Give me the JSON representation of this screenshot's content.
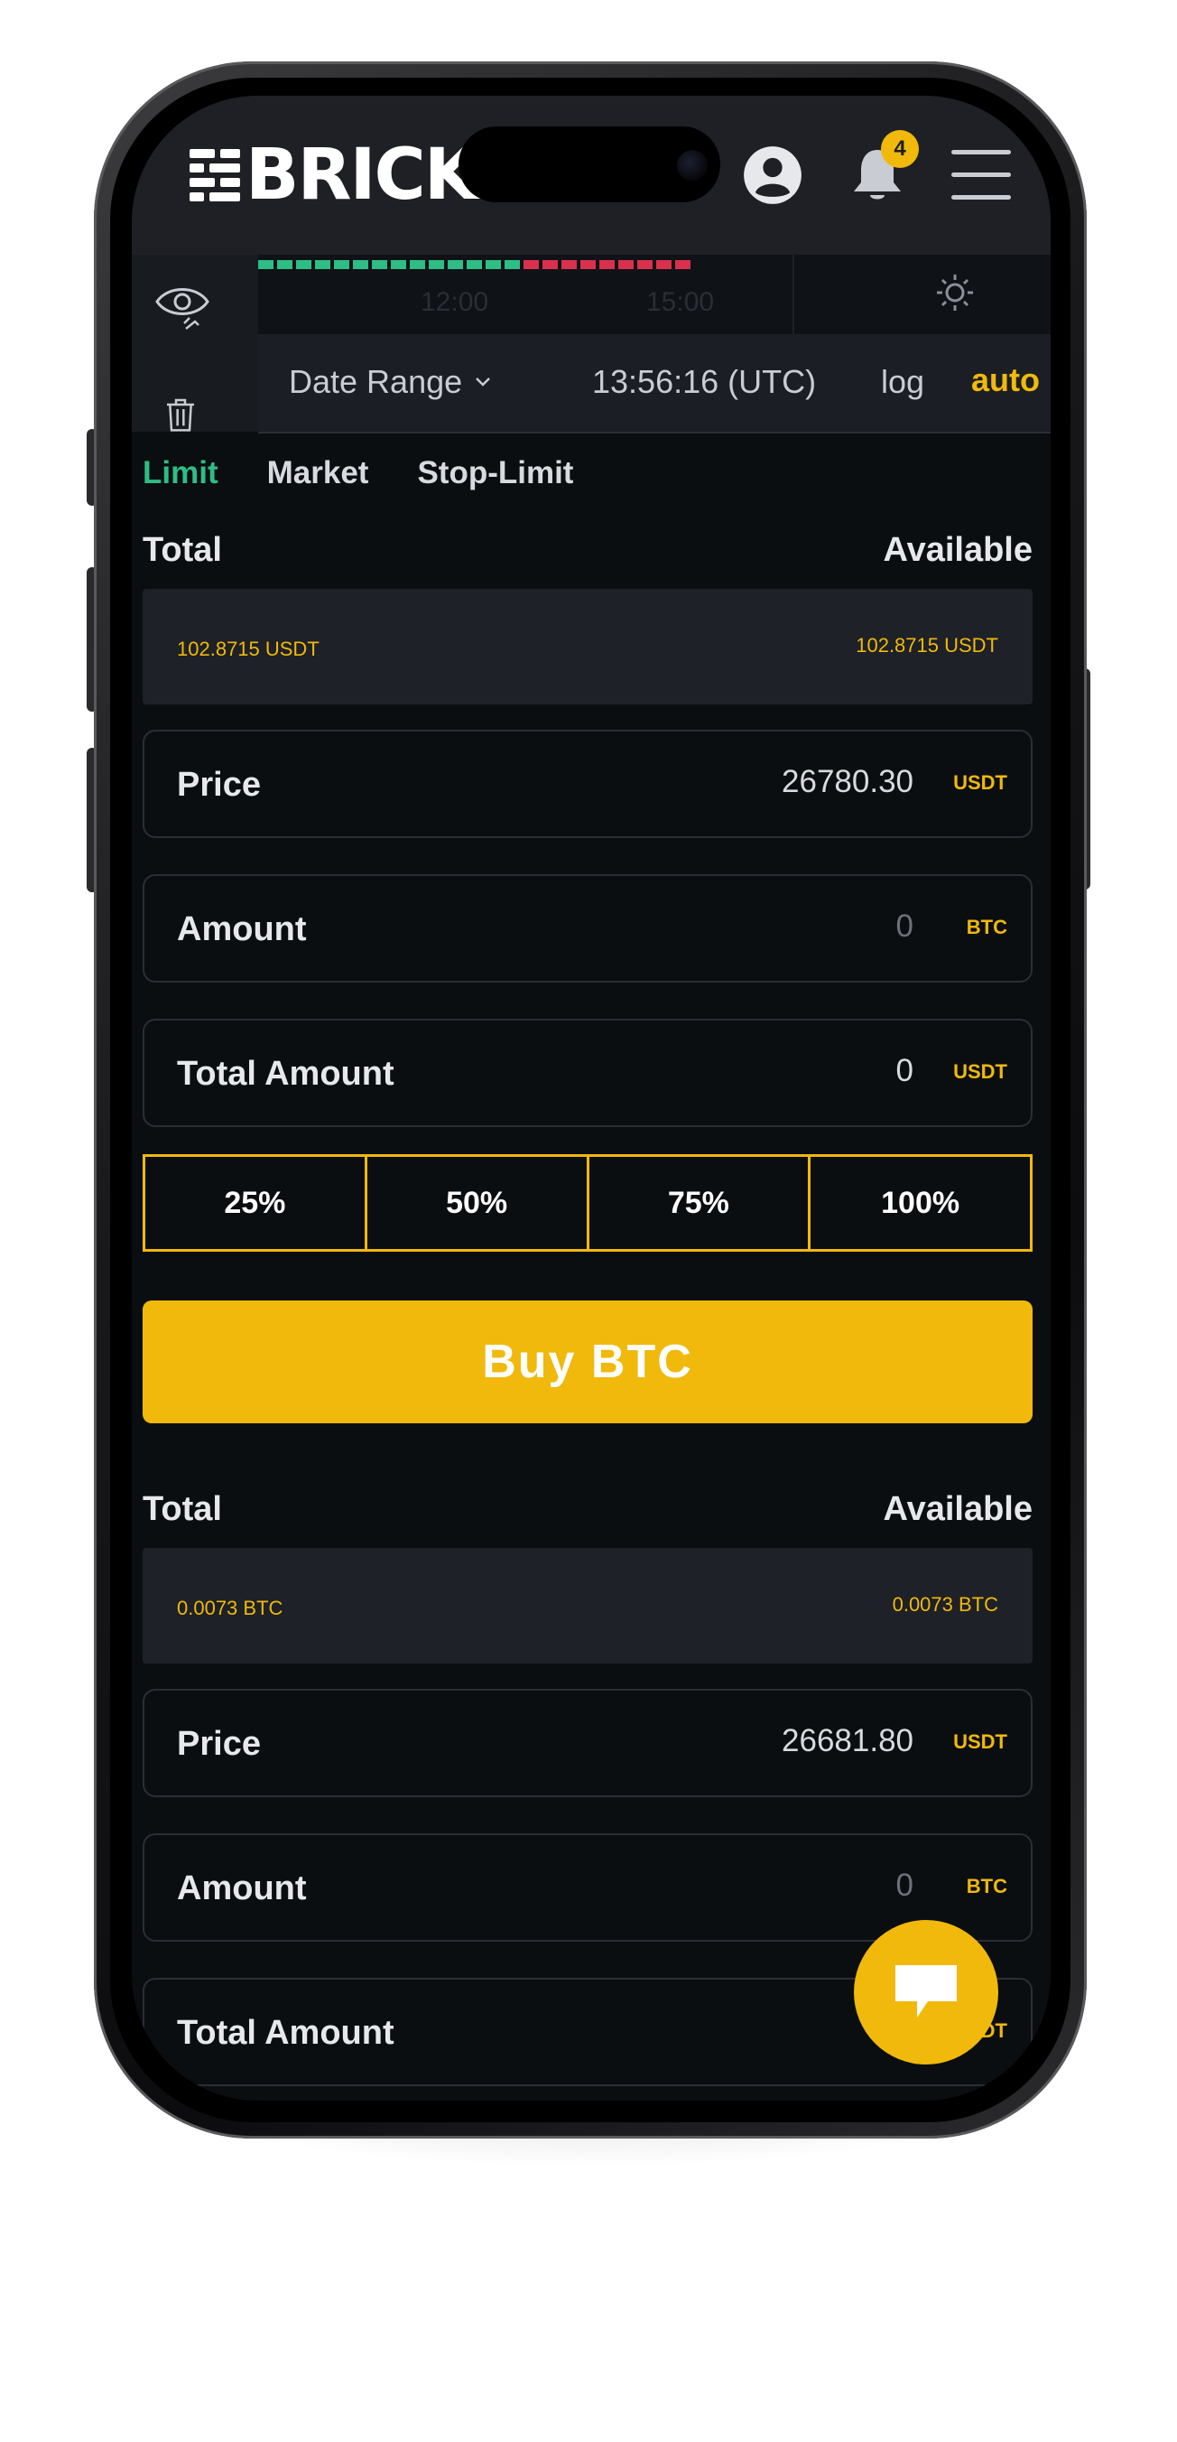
{
  "header": {
    "logo_text": "BRICK",
    "notification_count": "4",
    "icons": [
      "user-icon",
      "bell-icon",
      "menu-icon"
    ]
  },
  "chart": {
    "time_labels": [
      "12:00",
      "15:00"
    ],
    "date_range_label": "Date Range",
    "clock": "13:56:16 (UTC)",
    "log_label": "log",
    "auto_label": "auto"
  },
  "tabs": [
    {
      "label": "Limit",
      "active": true
    },
    {
      "label": "Market",
      "active": false
    },
    {
      "label": "Stop-Limit",
      "active": false
    }
  ],
  "buy": {
    "total_label": "Total",
    "available_label": "Available",
    "total_value": "102.8715 USDT",
    "available_value": "102.8715 USDT",
    "price_label": "Price",
    "price_value": "26780.30",
    "price_unit": "USDT",
    "amount_label": "Amount",
    "amount_value": "0",
    "amount_unit": "BTC",
    "total_amount_label": "Total Amount",
    "total_amount_value": "0",
    "total_amount_unit": "USDT",
    "percent_options": [
      "25%",
      "50%",
      "75%",
      "100%"
    ],
    "button_label": "Buy BTC"
  },
  "sell": {
    "total_label": "Total",
    "available_label": "Available",
    "total_value": "0.0073 BTC",
    "available_value": "0.0073 BTC",
    "price_label": "Price",
    "price_value": "26681.80",
    "price_unit": "USDT",
    "amount_label": "Amount",
    "amount_value": "0",
    "amount_unit": "BTC",
    "total_amount_label": "Total Amount",
    "total_amount_unit": "USDT"
  },
  "colors": {
    "accent": "#f0b90b",
    "active_tab": "#2ebd85",
    "background": "#0b0e11",
    "sell_red": "#d9304e"
  }
}
